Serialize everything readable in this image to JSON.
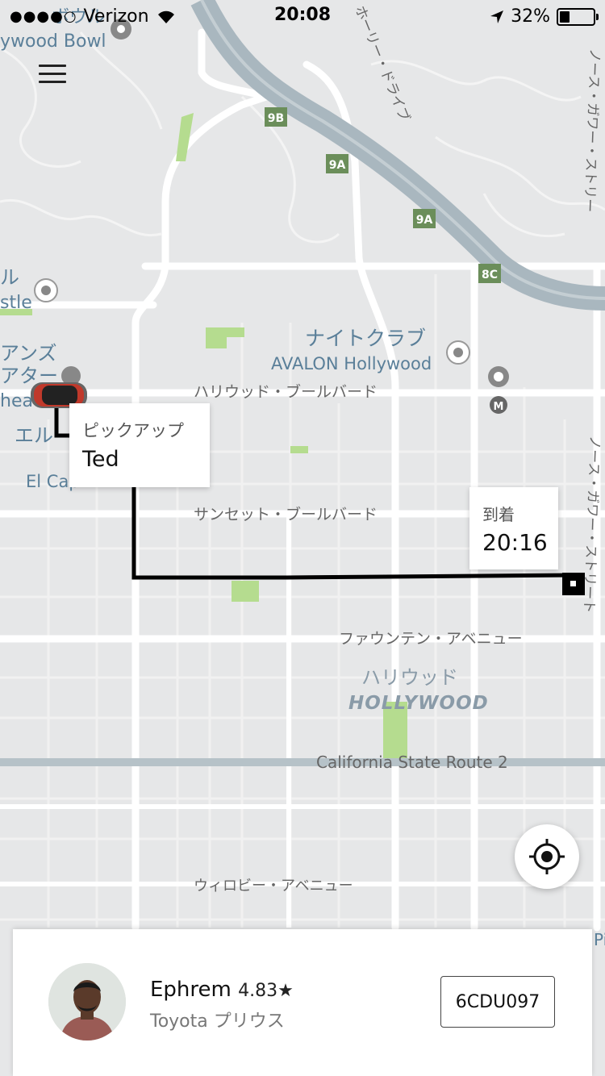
{
  "status_bar": {
    "signal": "●●●●○",
    "carrier": "Verizon",
    "time": "20:08",
    "battery": "32%"
  },
  "map": {
    "labels": {
      "hollywood_bowl": "ywood Bowl",
      "bowl_jp": "ボウル",
      "ru": "ル",
      "stle": "stle",
      "anzu": "アンズ",
      "ata": "アター",
      "heatre": "heatre",
      "eru": "エル",
      "el_cap": "El Cap",
      "nightclub": "ナイトクラブ",
      "avalon": "AVALON Hollywood",
      "hollywood_blvd": "ハリウッド・ブールバード",
      "sunset_blvd": "サンセット・ブールバード",
      "fountain_ave": "ファウンテン・アベニュー",
      "hollywood_jp": "ハリウッド",
      "hollywood_en": "HOLLYWOOD",
      "ca_route": "California State Route 2",
      "willoughby": "ウィロビー・アベニュー",
      "holly_drive": "ホーリー・ドライブ",
      "north_gower_1": "ノース・ガワー・ストリー",
      "north_gower_2": "ノース・ガワー・ストリート",
      "pi": "Pi"
    },
    "exits": [
      "9B",
      "9A",
      "9A",
      "8C"
    ]
  },
  "pickup": {
    "label": "ピックアップ",
    "name": "Ted"
  },
  "arrival": {
    "label": "到着",
    "time": "20:16"
  },
  "driver": {
    "name": "Ephrem",
    "rating": "4.83★",
    "vehicle": "Toyota プリウス",
    "plate": "6CDU097"
  },
  "colors": {
    "map_bg": "#e6e7e8",
    "road": "#ffffff",
    "freeway": "#a9b7bf",
    "park": "#b5dc8f",
    "route": "#000000"
  }
}
